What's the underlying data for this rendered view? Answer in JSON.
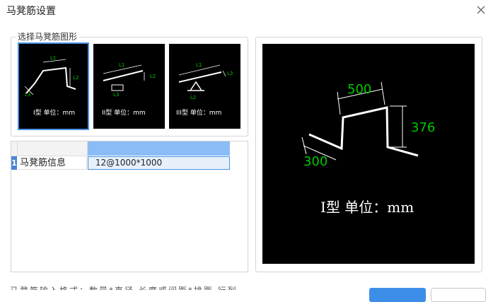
{
  "window": {
    "title": "马凳筋设置"
  },
  "shape_group": {
    "legend": "选择马凳筋图形",
    "options": [
      {
        "caption": "I型 单位：mm",
        "labels": [
          "L1",
          "L2",
          "L3"
        ],
        "selected": true
      },
      {
        "caption": "II型 单位：mm",
        "labels": [
          "L1",
          "L2",
          "L3"
        ],
        "selected": false
      },
      {
        "caption": "III型 单位：mm",
        "labels": [
          "L1",
          "L2",
          "L3"
        ],
        "selected": false
      }
    ]
  },
  "grid": {
    "rows": [
      {
        "num": "1",
        "label": "马凳筋信息",
        "value": " 12@1000*1000"
      }
    ]
  },
  "preview": {
    "dim_top": "500",
    "dim_right": "376",
    "dim_left": "300",
    "caption": "I型 单位：mm"
  },
  "footer": {
    "hint": "马凳筋输入格式：数量*直径 长度或间距*排距 行列"
  },
  "colors": {
    "accent": "#3d8ee8",
    "dim_green": "#00c800",
    "canvas": "#000000"
  }
}
